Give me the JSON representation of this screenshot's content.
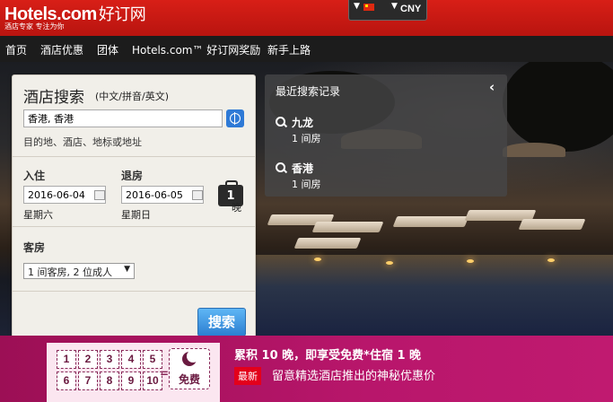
{
  "header": {
    "logo_text": "Hotels.com",
    "logo_cn": "好订网",
    "tagline": "酒店专家 专注为你",
    "currency": "CNY"
  },
  "nav": {
    "items": [
      "首页",
      "酒店优惠",
      "团体",
      "Hotels.com™ 好订网奖励",
      "新手上路"
    ]
  },
  "search": {
    "title": "酒店搜索",
    "subtitle": "(中文/拼音/英文)",
    "destination_value": "香港, 香港",
    "destination_hint": "目的地、酒店、地标或地址",
    "checkin_label": "入住",
    "checkin_value": "2016-06-04",
    "checkin_weekday": "星期六",
    "checkout_label": "退房",
    "checkout_value": "2016-06-05",
    "checkout_weekday": "星期日",
    "nights_count": "1",
    "nights_label": "晚",
    "guests_label": "客房",
    "guests_value": "1 间客房, 2 位成人",
    "search_button": "搜索"
  },
  "recent": {
    "title": "最近搜索记录",
    "items": [
      {
        "place": "九龙",
        "rooms": "1 间房"
      },
      {
        "place": "香港",
        "rooms": "1 间房"
      }
    ]
  },
  "promo": {
    "stamps": [
      "1",
      "2",
      "3",
      "4",
      "5",
      "6",
      "7",
      "8",
      "9",
      "10"
    ],
    "equals": "=",
    "free_label": "免费",
    "headline": "累积 10 晚，即享受免费*住宿 1 晚",
    "badge": "最新",
    "subline": "留意精选酒店推出的神秘优惠价"
  },
  "colors": {
    "brand_red": "#d81f17",
    "promo_magenta": "#b8166b",
    "search_blue": "#2c7fd1"
  }
}
